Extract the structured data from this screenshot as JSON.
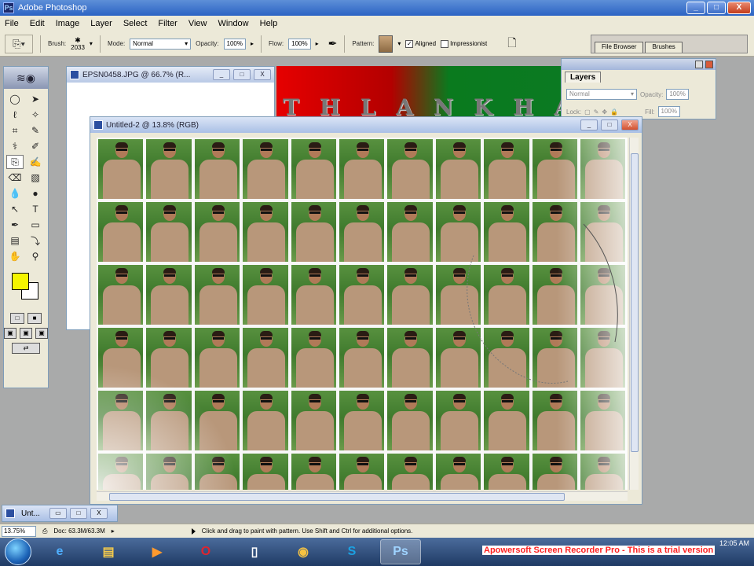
{
  "app": {
    "title": "Adobe Photoshop",
    "icon_glyph": "Ps",
    "window_controls": [
      "_",
      "□",
      "X"
    ]
  },
  "menu": [
    "File",
    "Edit",
    "Image",
    "Layer",
    "Select",
    "Filter",
    "View",
    "Window",
    "Help"
  ],
  "options": {
    "brush_label": "Brush:",
    "brush_size": "2033",
    "mode_label": "Mode:",
    "mode_value": "Normal",
    "opacity_label": "Opacity:",
    "opacity_value": "100%",
    "flow_label": "Flow:",
    "flow_value": "100%",
    "pattern_label": "Pattern:",
    "aligned_label": "Aligned",
    "aligned_checked": true,
    "impressionist_label": "Impressionist",
    "impressionist_checked": false
  },
  "palette_well": {
    "tabs": [
      "File Browser",
      "Brushes"
    ]
  },
  "documents": {
    "background": {
      "title": "EPSN0458.JPG @ 66.7% (R...",
      "banner_text": "T H L A N  K H A"
    },
    "active": {
      "title": "Untitled-2 @ 13.8% (RGB)",
      "grid_cols": 11,
      "grid_rows": 6
    }
  },
  "layers_panel": {
    "tab_label": "Layers",
    "blend_mode": "Normal",
    "opacity_label": "Opacity:",
    "opacity_value": "100%",
    "lock_label": "Lock:",
    "fill_label": "Fill:",
    "fill_value": "100%"
  },
  "minimized_doc": {
    "title": "Unt..."
  },
  "status": {
    "zoom": "13.75%",
    "doc_size": "Doc: 63.3M/63.3M",
    "hint": "Click and drag to paint with pattern. Use Shift and Ctrl for additional options."
  },
  "taskbar": {
    "time": "12:05 AM",
    "trial_notice": "Apowersoft Screen Recorder Pro - This is a trial version"
  },
  "colors": {
    "foreground": "#f4f400",
    "background": "#ffffff",
    "banner_red": "#e60000",
    "banner_green": "#0a7a1e"
  }
}
